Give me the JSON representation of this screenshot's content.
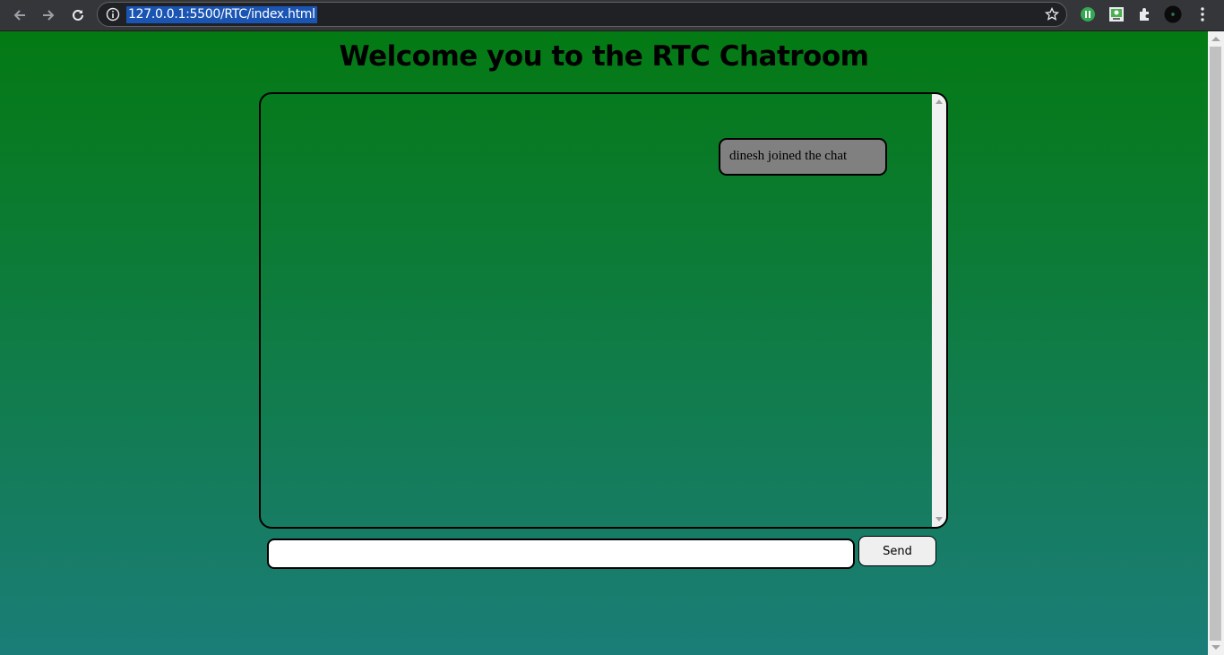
{
  "browser": {
    "url": "127.0.0.1:5500/RTC/index.html",
    "icons": [
      "back-arrow-icon",
      "forward-arrow-icon",
      "reload-icon",
      "site-info-icon",
      "bookmark-star-icon",
      "extension-green-icon",
      "extension-screen-icon",
      "extensions-puzzle-icon",
      "profile-avatar-icon",
      "menu-kebab-icon"
    ]
  },
  "page": {
    "title": "Welcome you to the RTC Chatroom",
    "messages": [
      {
        "text": "dinesh joined the chat"
      }
    ],
    "input": {
      "value": "",
      "placeholder": ""
    },
    "send_label": "Send"
  },
  "colors": {
    "gradient_top": "#047a13",
    "gradient_bottom": "#1b7d78",
    "message_bg": "#808080",
    "url_highlight": "#1a55b4"
  }
}
